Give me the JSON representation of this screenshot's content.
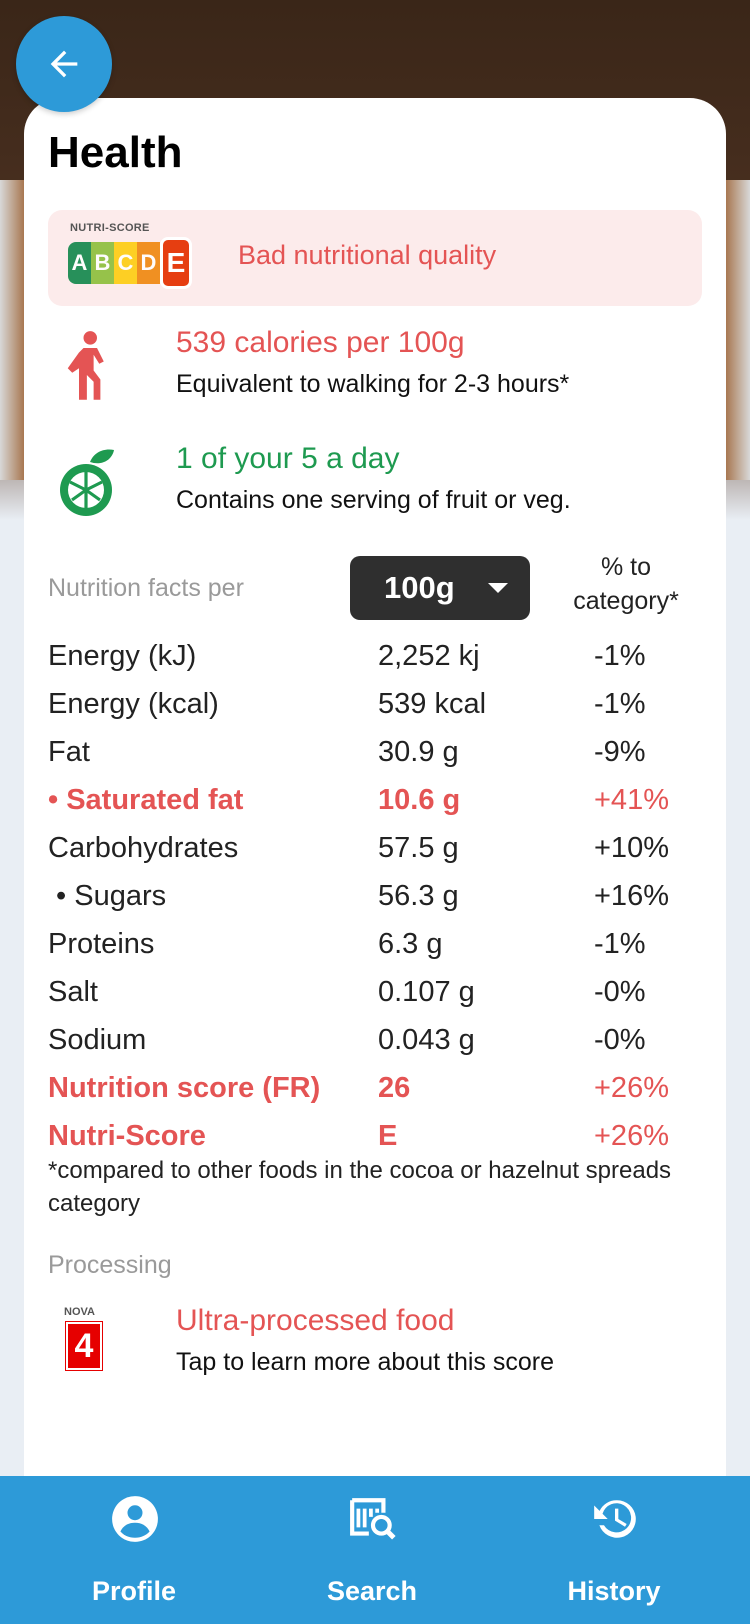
{
  "header": {
    "title": "Health",
    "back_label": "back"
  },
  "nutriscore": {
    "logo_label": "NUTRI-SCORE",
    "grades": [
      "A",
      "B",
      "C",
      "D",
      "E"
    ],
    "grade_colors": [
      "#038141",
      "#85bb2f",
      "#fecb02",
      "#ee8100",
      "#e63e11"
    ],
    "selected": "E",
    "text": "Bad nutritional quality"
  },
  "calories": {
    "title": "539 calories per 100g",
    "subtitle": "Equivalent to walking for 2-3 hours*"
  },
  "five_a_day": {
    "title": "1 of your 5 a day",
    "subtitle": "Contains one serving of fruit or veg."
  },
  "nutrition_facts": {
    "label": "Nutrition facts per",
    "selected_unit": "100g",
    "pct_header": "% to category*",
    "rows": [
      {
        "name": "Energy (kJ)",
        "value": "2,252 kj",
        "pct": "-1%",
        "bad": false
      },
      {
        "name": "Energy (kcal)",
        "value": "539 kcal",
        "pct": "-1%",
        "bad": false
      },
      {
        "name": "Fat",
        "value": "30.9 g",
        "pct": "-9%",
        "bad": false
      },
      {
        "name": "• Saturated fat",
        "value": "10.6 g",
        "pct": "+41%",
        "bad": true
      },
      {
        "name": "Carbohydrates",
        "value": "57.5 g",
        "pct": "+10%",
        "bad": false
      },
      {
        "name": " • Sugars",
        "value": "56.3 g",
        "pct": "+16%",
        "bad": false
      },
      {
        "name": "Proteins",
        "value": "6.3 g",
        "pct": "-1%",
        "bad": false
      },
      {
        "name": "Salt",
        "value": "0.107 g",
        "pct": "-0%",
        "bad": false
      },
      {
        "name": "Sodium",
        "value": "0.043 g",
        "pct": "-0%",
        "bad": false
      },
      {
        "name": "Nutrition score (FR)",
        "value": "26",
        "pct": "+26%",
        "bad": true
      },
      {
        "name": "Nutri-Score",
        "value": "E",
        "pct": "+26%",
        "bad": true
      }
    ],
    "footnote": "*compared to other foods in the cocoa or hazelnut spreads category"
  },
  "processing": {
    "label": "Processing",
    "nova_label": "NOVA",
    "nova_group": "4",
    "title": "Ultra-processed food",
    "subtitle": "Tap to learn more about this score"
  },
  "bottom_nav": [
    {
      "label": "Profile",
      "icon": "profile-icon"
    },
    {
      "label": "Search",
      "icon": "search-icon"
    },
    {
      "label": "History",
      "icon": "history-icon"
    }
  ],
  "colors": {
    "accent": "#2d9ad8",
    "bad": "#e45454",
    "good": "#1e9a50"
  }
}
